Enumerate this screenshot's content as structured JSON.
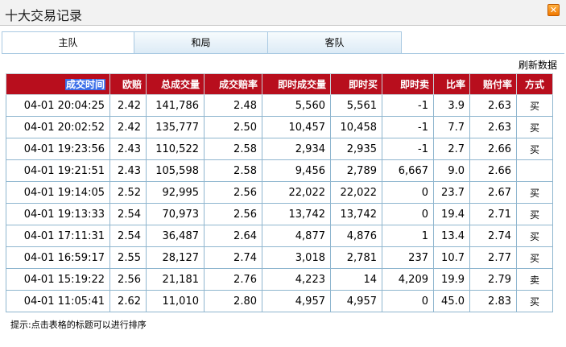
{
  "window": {
    "title": "十大交易记录",
    "close_glyph": "✕"
  },
  "tabs": [
    {
      "label": "主队",
      "active": true
    },
    {
      "label": "和局",
      "active": false
    },
    {
      "label": "客队",
      "active": false
    }
  ],
  "refresh_label": "刷新数据",
  "table": {
    "headers": [
      "成交时间",
      "欧赔",
      "总成交量",
      "成交赔率",
      "即时成交量",
      "即时买",
      "即时卖",
      "比率",
      "赔付率",
      "方式"
    ],
    "sorted_column": "成交时间",
    "rows": [
      [
        "04-01 20:04:25",
        "2.42",
        "141,786",
        "2.48",
        "5,560",
        "5,561",
        "-1",
        "3.9",
        "2.63",
        "买"
      ],
      [
        "04-01 20:02:52",
        "2.42",
        "135,777",
        "2.50",
        "10,457",
        "10,458",
        "-1",
        "7.7",
        "2.63",
        "买"
      ],
      [
        "04-01 19:23:56",
        "2.43",
        "110,522",
        "2.58",
        "2,934",
        "2,935",
        "-1",
        "2.7",
        "2.66",
        "买"
      ],
      [
        "04-01 19:21:51",
        "2.43",
        "105,598",
        "2.58",
        "9,456",
        "2,789",
        "6,667",
        "9.0",
        "2.66",
        ""
      ],
      [
        "04-01 19:14:05",
        "2.52",
        "92,995",
        "2.56",
        "22,022",
        "22,022",
        "0",
        "23.7",
        "2.67",
        "买"
      ],
      [
        "04-01 19:13:33",
        "2.54",
        "70,973",
        "2.56",
        "13,742",
        "13,742",
        "0",
        "19.4",
        "2.71",
        "买"
      ],
      [
        "04-01 17:11:31",
        "2.54",
        "36,487",
        "2.64",
        "4,877",
        "4,876",
        "1",
        "13.4",
        "2.74",
        "买"
      ],
      [
        "04-01 16:59:17",
        "2.55",
        "28,127",
        "2.74",
        "3,018",
        "2,781",
        "237",
        "10.7",
        "2.77",
        "买"
      ],
      [
        "04-01 15:19:22",
        "2.56",
        "21,181",
        "2.76",
        "4,223",
        "14",
        "4,209",
        "19.9",
        "2.79",
        "卖"
      ],
      [
        "04-01 11:05:41",
        "2.62",
        "11,010",
        "2.80",
        "4,957",
        "4,957",
        "0",
        "45.0",
        "2.83",
        "买"
      ]
    ]
  },
  "hint": "提示:点击表格的标题可以进行排序",
  "colors": {
    "header_bg": "#b80e1d",
    "buy": "#d40000",
    "sell": "#0a8a0a",
    "border": "#8fb6cf"
  }
}
